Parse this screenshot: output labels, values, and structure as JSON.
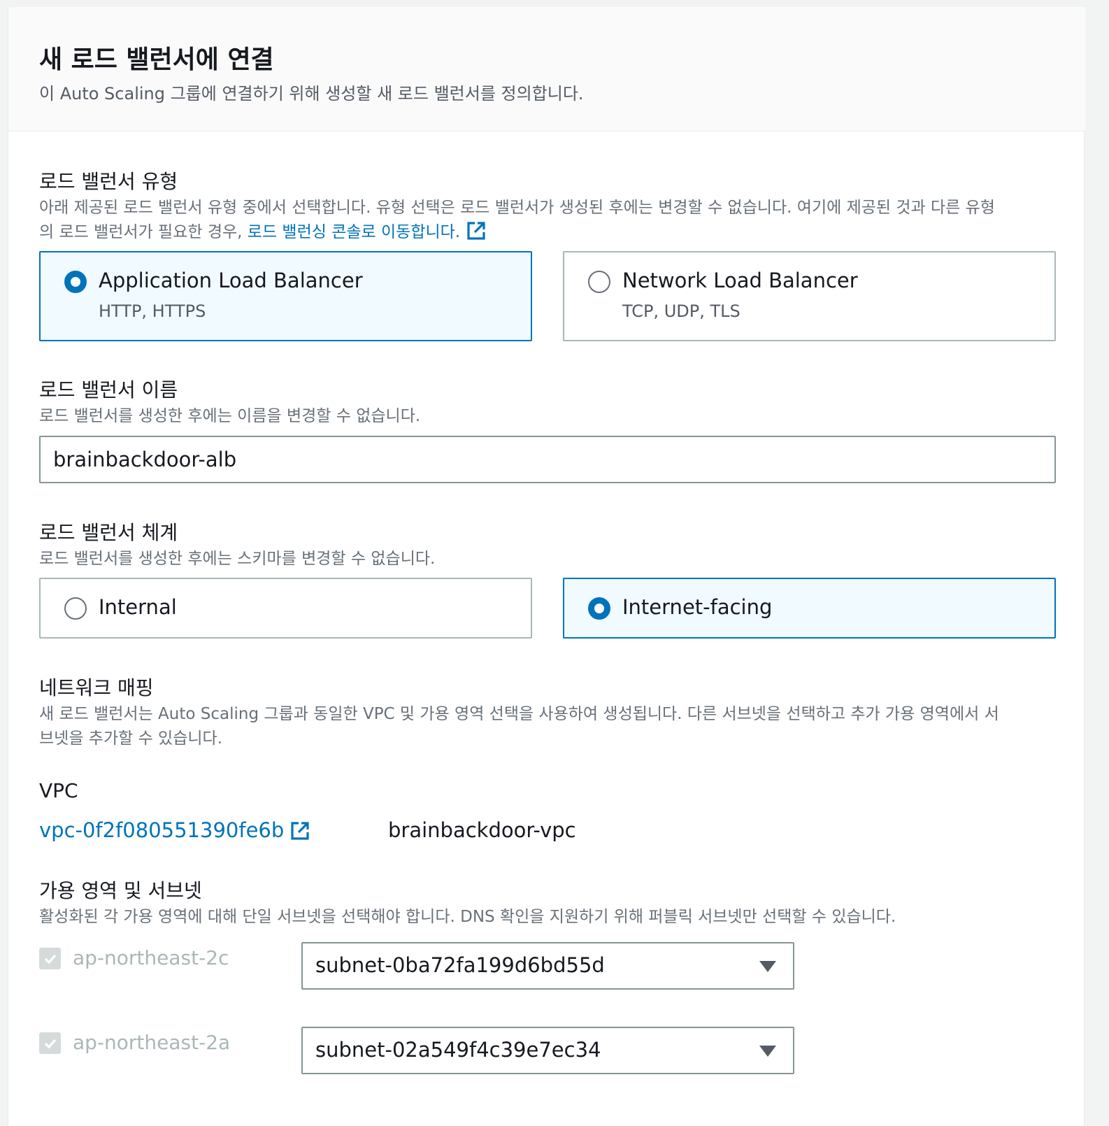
{
  "header": {
    "title": "새 로드 밸런서에 연결",
    "description": "이 Auto Scaling 그룹에 연결하기 위해 생성할 새 로드 밸런서를 정의합니다."
  },
  "lb_type": {
    "label": "로드 밸런서 유형",
    "description_line1": "아래 제공된 로드 밸런서 유형 중에서 선택합니다. 유형 선택은 로드 밸런서가 생성된 후에는 변경할 수 없습니다. 여기에 제공된 것과 다른 유형",
    "description_line2": "의 로드 밸런서가 필요한 경우, ",
    "console_link": "로드 밸런싱 콘솔로 이동합니다.",
    "options": [
      {
        "title": "Application Load Balancer",
        "subtitle": "HTTP, HTTPS",
        "selected": true
      },
      {
        "title": "Network Load Balancer",
        "subtitle": "TCP, UDP, TLS",
        "selected": false
      }
    ]
  },
  "lb_name": {
    "label": "로드 밸런서 이름",
    "description": "로드 밸런서를 생성한 후에는 이름을 변경할 수 없습니다.",
    "value": "brainbackdoor-alb"
  },
  "lb_scheme": {
    "label": "로드 밸런서 체계",
    "description": "로드 밸런서를 생성한 후에는 스키마를 변경할 수 없습니다.",
    "options": [
      {
        "title": "Internal",
        "selected": false
      },
      {
        "title": "Internet-facing",
        "selected": true
      }
    ]
  },
  "network_mapping": {
    "label": "네트워크 매핑",
    "description_line1": "새 로드 밸런서는 Auto Scaling 그룹과 동일한 VPC 및 가용 영역 선택을 사용하여 생성됩니다. 다른 서브넷을 선택하고 추가 가용 영역에서 서",
    "description_line2": "브넷을 추가할 수 있습니다."
  },
  "vpc": {
    "label": "VPC",
    "id": "vpc-0f2f080551390fe6b",
    "name": "brainbackdoor-vpc"
  },
  "az_subnets": {
    "label": "가용 영역 및 서브넷",
    "description": "활성화된 각 가용 영역에 대해 단일 서브넷을 선택해야 합니다. DNS 확인을 지원하기 위해 퍼블릭 서브넷만 선택할 수 있습니다.",
    "rows": [
      {
        "zone": "ap-northeast-2c",
        "checked": true,
        "subnet": "subnet-0ba72fa199d6bd55d"
      },
      {
        "zone": "ap-northeast-2a",
        "checked": true,
        "subnet": "subnet-02a549f4c39e7ec34"
      }
    ]
  },
  "colors": {
    "accent": "#0073bb",
    "selected_bg": "#f1faff",
    "border": "#aab7b8",
    "muted_text": "#687078"
  },
  "icons": [
    "external-link-icon",
    "radio-icon",
    "checkbox-icon",
    "caret-down-icon"
  ]
}
